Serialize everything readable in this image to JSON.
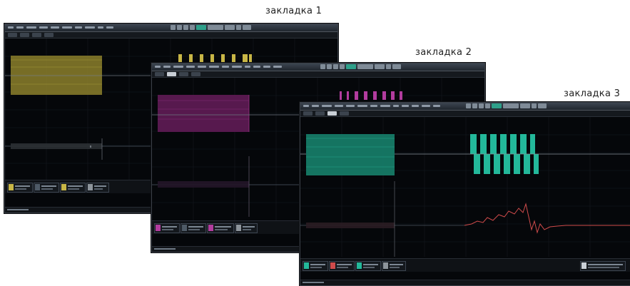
{
  "captions": {
    "tab1": "закладка 1",
    "tab2": "закладка 2",
    "tab3": "закладка 3"
  },
  "windows": [
    {
      "id": "window-1",
      "trace_color": "#b8a83a",
      "active_tab": 1
    },
    {
      "id": "window-2",
      "trace_color": "#b0379a",
      "active_tab": 1
    },
    {
      "id": "window-3",
      "trace_color": "#23b89a",
      "active_tab": 1
    }
  ],
  "colors": {
    "screen_background": "#05070a",
    "menubar": "#2a323b",
    "math_trace": "#d04b4b",
    "baseline": "#6d7680"
  },
  "icons": [
    "toolbar-icon",
    "run-stop-icon",
    "trigger-icon"
  ]
}
